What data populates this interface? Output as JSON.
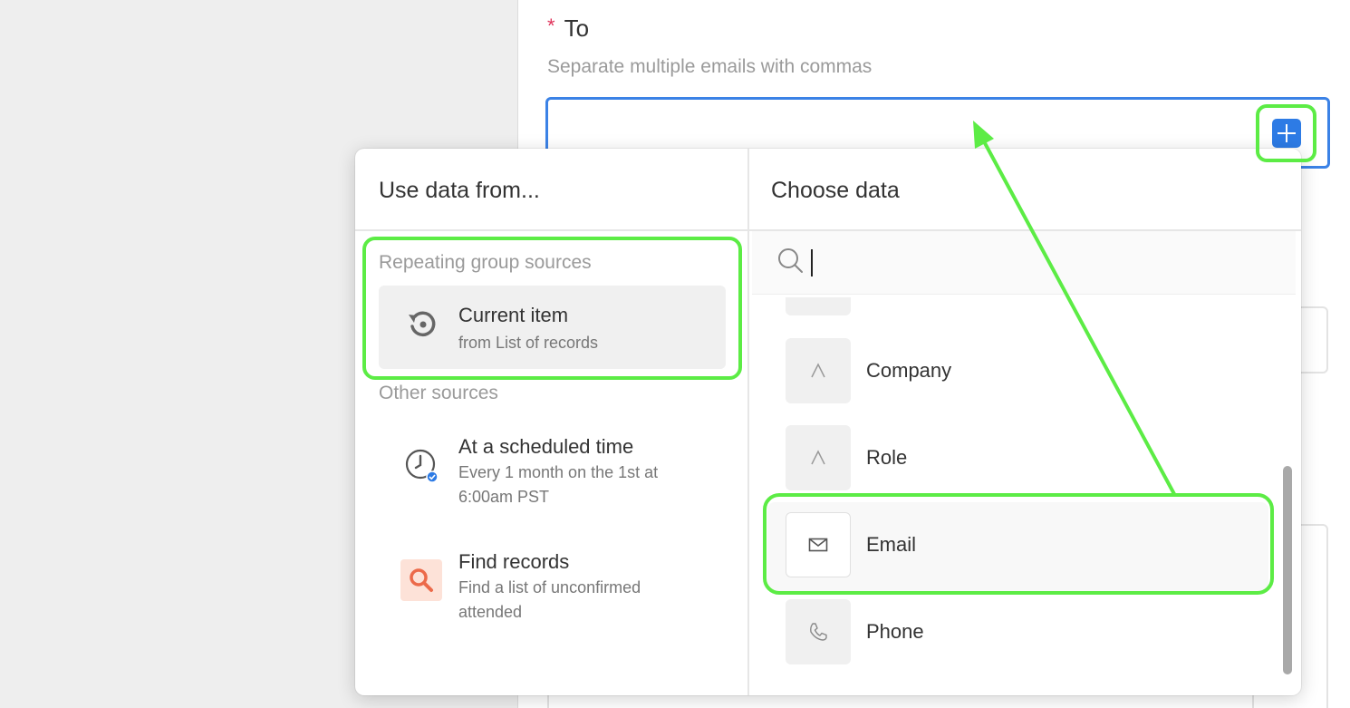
{
  "form": {
    "required_mark": "*",
    "to_label": "To",
    "to_help": "Separate multiple emails with commas"
  },
  "popup": {
    "left_title": "Use data from...",
    "right_title": "Choose data",
    "repeating_label": "Repeating group sources",
    "current_item": {
      "title": "Current item",
      "subtitle": "from List of records"
    },
    "other_label": "Other sources",
    "scheduled": {
      "title": "At a scheduled time",
      "subtitle": "Every 1 month on the 1st at 6:00am PST"
    },
    "find": {
      "title": "Find records",
      "subtitle": "Find a list of unconfirmed attended"
    },
    "search_value": "",
    "fields": [
      {
        "label": "Company",
        "icon": "text-type-icon"
      },
      {
        "label": "Role",
        "icon": "text-type-icon"
      },
      {
        "label": "Email",
        "icon": "envelope-icon"
      },
      {
        "label": "Phone",
        "icon": "phone-icon"
      }
    ]
  },
  "colors": {
    "accent": "#2d7be5",
    "highlight": "#5cec45",
    "required": "#e0345b",
    "find_icon": "#ec6a4a"
  }
}
